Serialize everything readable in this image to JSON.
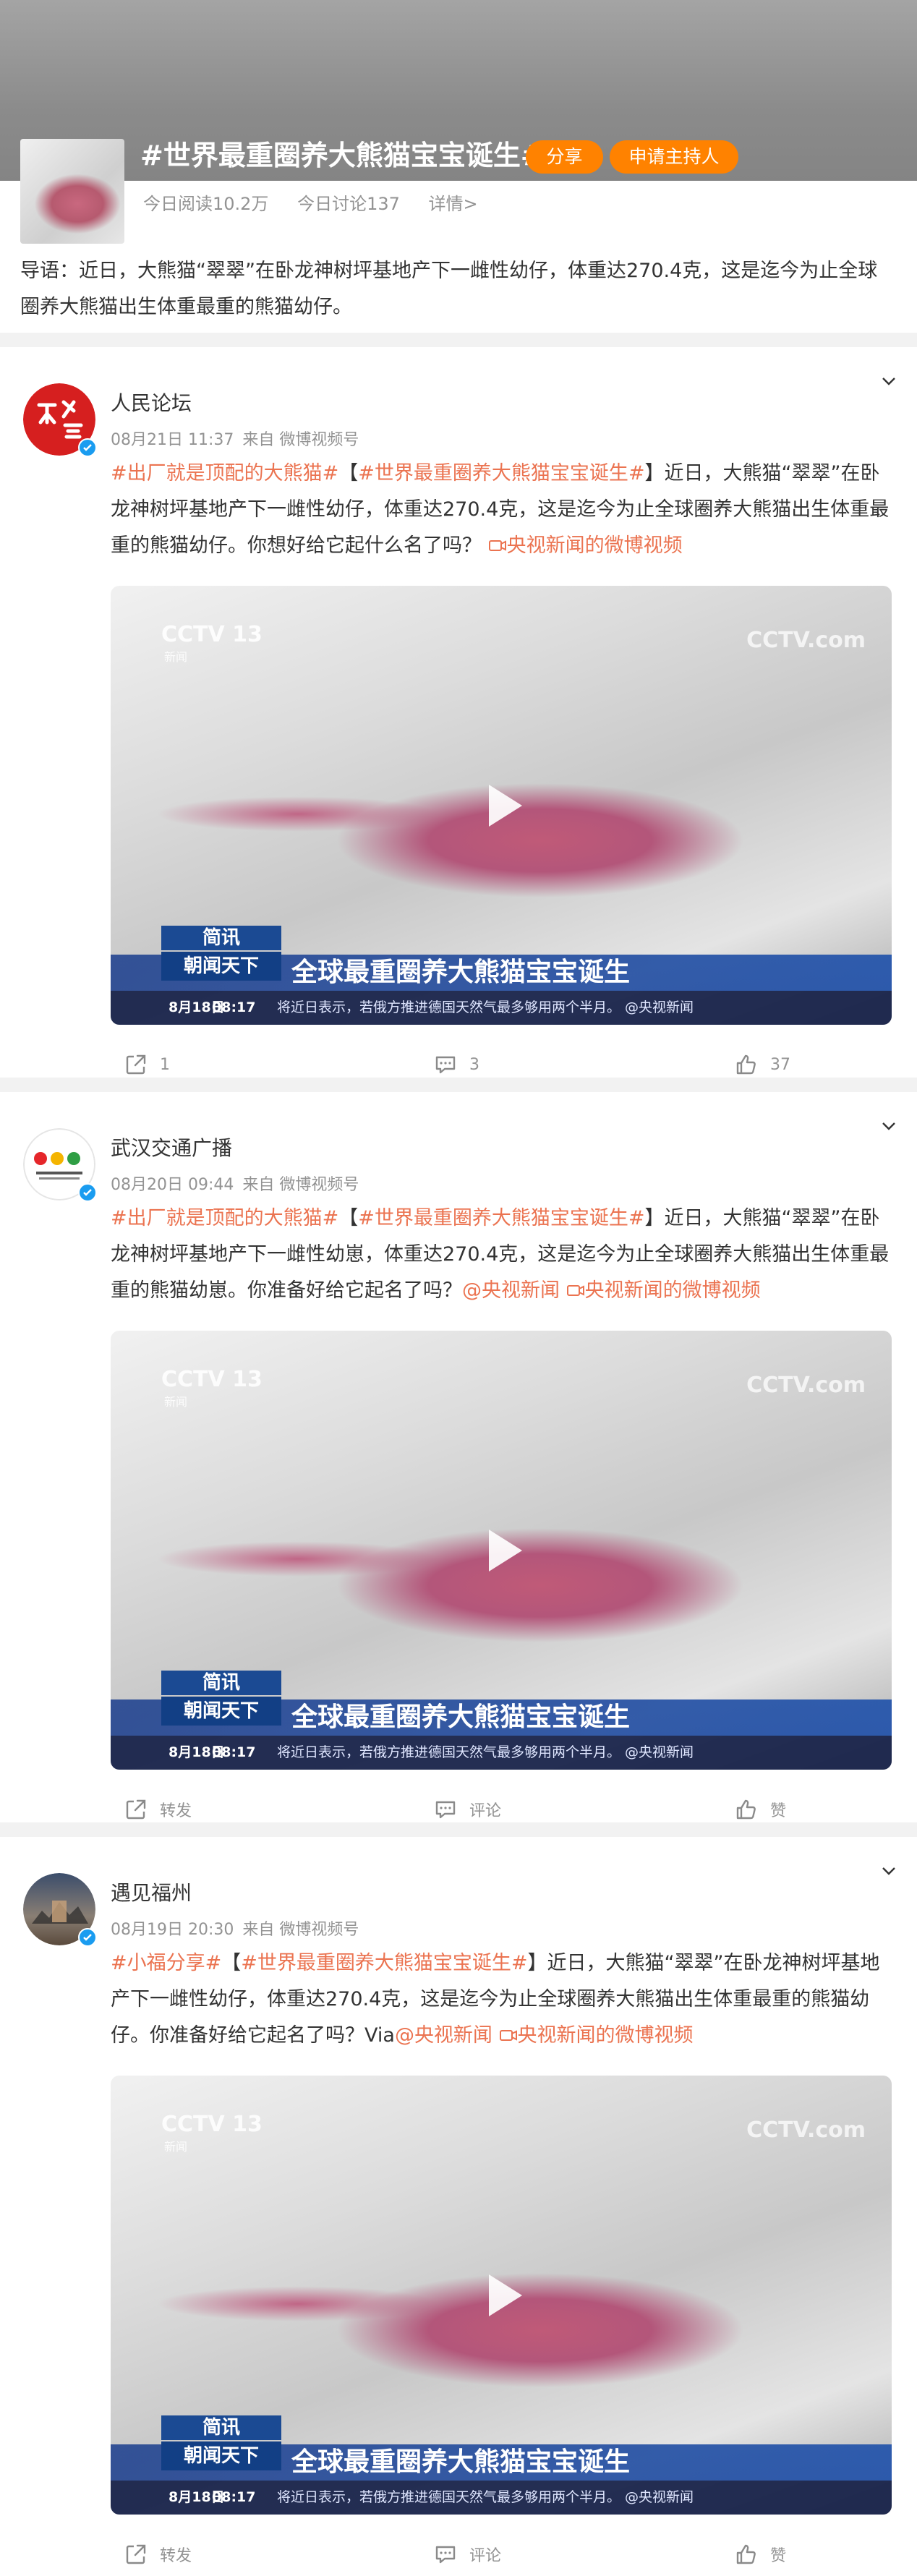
{
  "topic": {
    "title": "#世界最重圈养大熊猫宝宝诞生#",
    "share_label": "分享",
    "host_label": "申请主持人",
    "reads": "今日阅读10.2万",
    "discussions": "今日讨论137",
    "details": "详情>",
    "intro": "导语：近日，大熊猫“翠翠”在卧龙神树坪基地产下一雌性幼仔，体重达270.4克，这是迄今为止全球圈养大熊猫出生体重最重的熊猫幼仔。"
  },
  "posts": [
    {
      "author": "人民论坛",
      "date": "08月21日 11:37",
      "source": "来自 微博视频号",
      "hashtag1": "#出厂就是顶配的大熊猫#",
      "bracket_open": "【",
      "hashtag2": "#世界最重圈养大熊猫宝宝诞生#",
      "text": "】近日，大熊猫“翠翠”在卧龙神树坪基地产下一雌性幼仔，体重达270.4克，这是迄今为止全球圈养大熊猫出生体重最重的熊猫幼仔。你想好给它起什么名了吗？",
      "mention": "",
      "link": "央视新闻的微博视频",
      "repost": "1",
      "comment": "3",
      "like": "37"
    },
    {
      "author": "武汉交通广播",
      "date": "08月20日 09:44",
      "source": "来自 微博视频号",
      "hashtag1": "#出厂就是顶配的大熊猫#",
      "bracket_open": "【",
      "hashtag2": "#世界最重圈养大熊猫宝宝诞生#",
      "text": "】近日，大熊猫“翠翠”在卧龙神树坪基地产下一雌性幼崽，体重达270.4克，这是迄今为止全球圈养大熊猫出生体重最重的熊猫幼崽。你准备好给它起名了吗？",
      "mention": "@央视新闻",
      "link": "央视新闻的微博视频",
      "repost": "转发",
      "comment": "评论",
      "like": "赞"
    },
    {
      "author": "遇见福州",
      "date": "08月19日 20:30",
      "source": "来自 微博视频号",
      "hashtag1": "#小福分享#",
      "bracket_open": "【",
      "hashtag2": "#世界最重圈养大熊猫宝宝诞生#",
      "text": "】近日，大熊猫“翠翠”在卧龙神树坪基地产下一雌性幼仔，体重达270.4克，这是迄今为止全球圈养大熊猫出生体重最重的熊猫幼仔。你准备好给它起名了吗？Via",
      "mention": "@央视新闻",
      "link": "央视新闻的微博视频",
      "repost": "转发",
      "comment": "评论",
      "like": "赞"
    }
  ],
  "video": {
    "channel_logo": "CCTV 13",
    "channel_sub": "新闻",
    "watermark": "CCTV.com",
    "tag1": "简讯",
    "tag2": "朝闻天下",
    "headline": "全球最重圈养大熊猫宝宝诞生",
    "date": "8月18日",
    "time": "08:17",
    "ticker": "将近日表示，若俄方推进德国天然气最多够用两个半月。 @央视新闻"
  },
  "colors": {
    "accent": "#ff8200",
    "link": "#eb7350",
    "verified": "#1a9cf0"
  }
}
